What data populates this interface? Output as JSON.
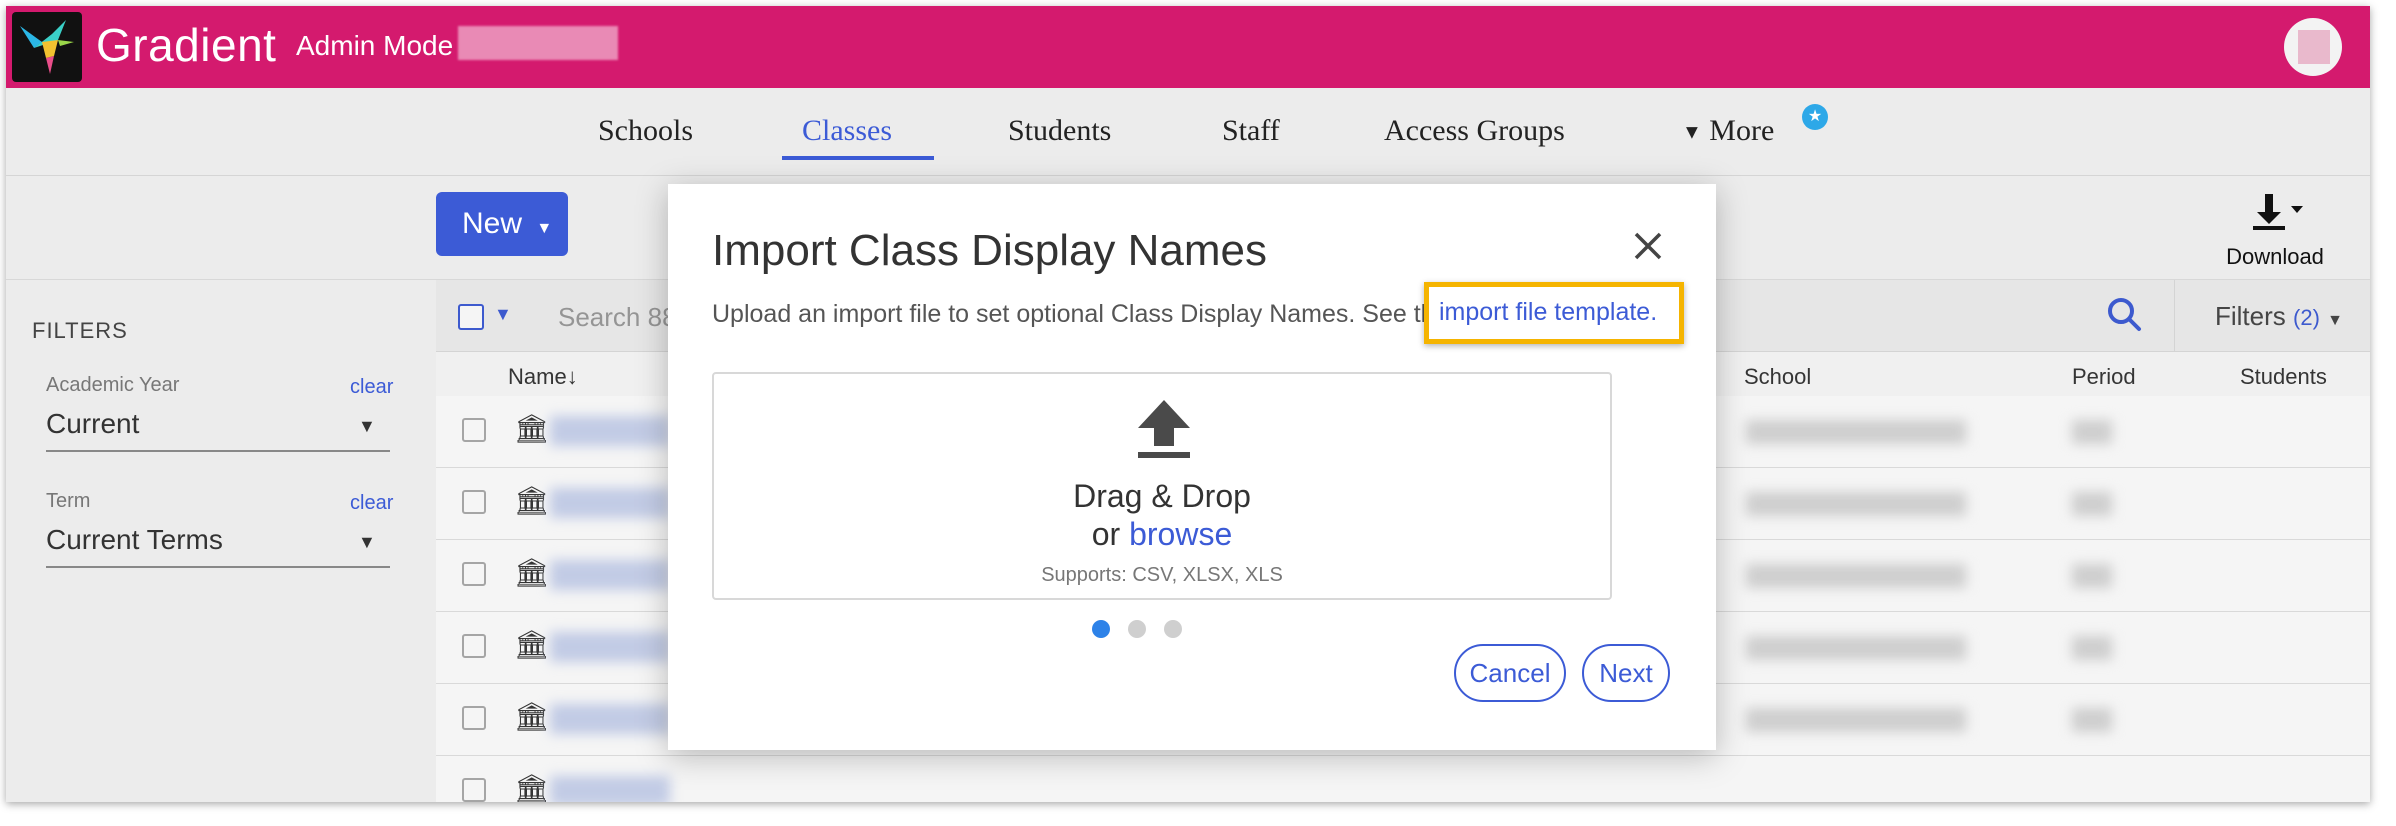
{
  "header": {
    "brand": "Gradient",
    "mode_label": "Admin Mode",
    "colors": {
      "bar": "#d41a6e",
      "accent": "#3c5bd6",
      "highlight": "#f5b400"
    }
  },
  "nav": {
    "items": [
      {
        "label": "Schools"
      },
      {
        "label": "Classes",
        "active": true
      },
      {
        "label": "Students"
      },
      {
        "label": "Staff"
      },
      {
        "label": "Access Groups"
      },
      {
        "label": "More",
        "icon": "caret-down-icon"
      }
    ],
    "badge_icon": "star-badge-icon"
  },
  "toolbar": {
    "new_label": "New",
    "download_label": "Download"
  },
  "filters": {
    "title": "FILTERS",
    "academic_year": {
      "label": "Academic Year",
      "clear": "clear",
      "value": "Current"
    },
    "term": {
      "label": "Term",
      "clear": "clear",
      "value": "Current Terms"
    }
  },
  "table": {
    "search_placeholder": "Search 88",
    "filters_label": "Filters",
    "filters_count": "(2)",
    "columns": {
      "name": "Name",
      "name_sort": "↓",
      "school": "School",
      "period": "Period",
      "students": "Students"
    },
    "row_icon": "institution-icon"
  },
  "modal": {
    "title": "Import Class Display Names",
    "description": "Upload an import file to set optional Class Display Names. See the",
    "link_text": "import file template.",
    "drop_line1": "Drag & Drop",
    "drop_or": "or ",
    "drop_browse": "browse",
    "supports": "Supports: CSV, XLSX, XLS",
    "step_current": 1,
    "step_total": 3,
    "cancel_label": "Cancel",
    "next_label": "Next"
  }
}
